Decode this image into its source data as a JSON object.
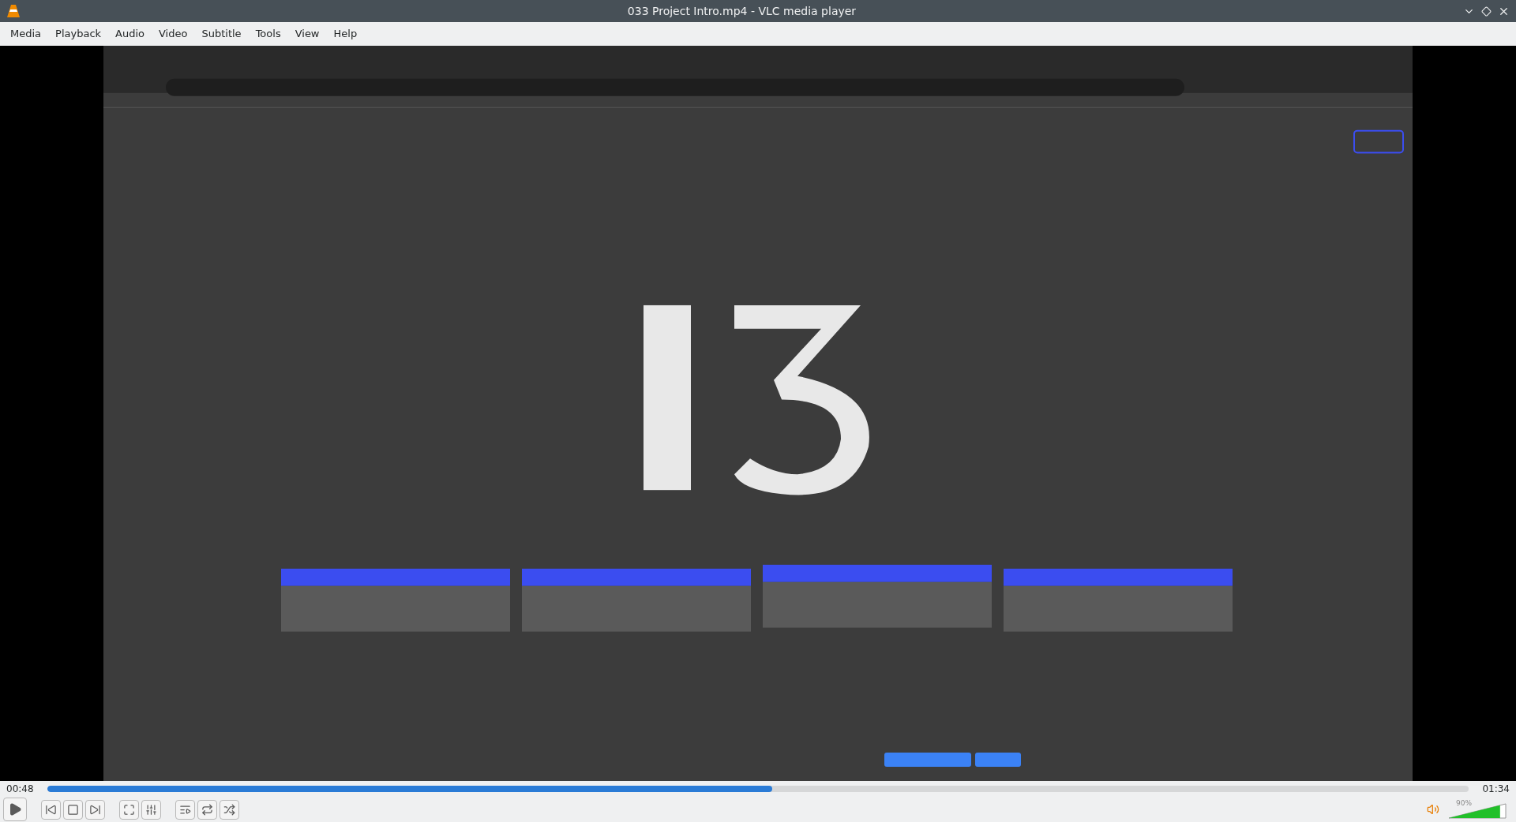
{
  "window": {
    "title": "033 Project Intro.mp4 - VLC media player"
  },
  "menu": [
    "Media",
    "Playback",
    "Audio",
    "Video",
    "Subtitle",
    "Tools",
    "View",
    "Help"
  ],
  "seek": {
    "elapsed": "00:48",
    "total": "01:34",
    "level": 0.51
  },
  "volume": {
    "reading": "90%",
    "level": 0.9,
    "muted": false
  }
}
